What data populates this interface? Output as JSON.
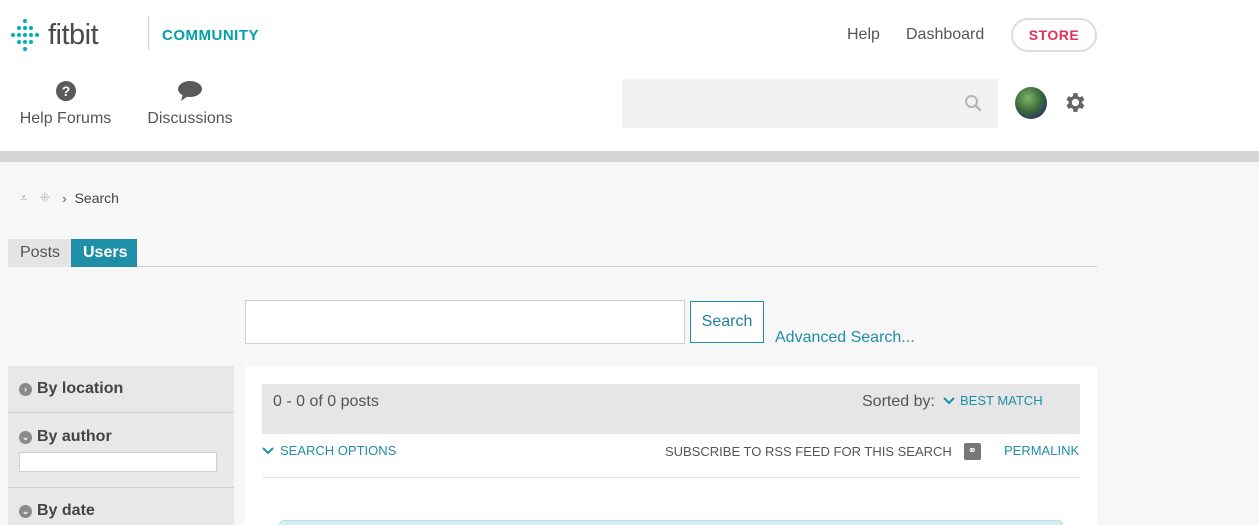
{
  "header": {
    "brand": "fitbit",
    "section": "COMMUNITY",
    "links": [
      "Help",
      "Dashboard"
    ],
    "store_label": "STORE",
    "store_color": "#e4305a",
    "nav": [
      {
        "label": "Help Forums",
        "icon": "question-circle-icon"
      },
      {
        "label": "Discussions",
        "icon": "speech-bubble-icon"
      }
    ],
    "search_placeholder": ""
  },
  "breadcrumb": {
    "items": [
      "Search"
    ]
  },
  "tabs": {
    "posts": "Posts",
    "users": "Users",
    "active": "Users"
  },
  "search": {
    "value": "",
    "button": "Search",
    "advanced": "Advanced Search..."
  },
  "filters": {
    "location": "By location",
    "author": "By author",
    "author_value": "",
    "date": "By date"
  },
  "results": {
    "count": "0 - 0 of 0 posts",
    "sorted_label": "Sorted by:",
    "sorted_value": "BEST MATCH",
    "options": "SEARCH OPTIONS",
    "rss": "SUBSCRIBE TO RSS FEED FOR THIS SEARCH",
    "permalink": "PERMALINK"
  },
  "colors": {
    "accent": "#1f8fa8",
    "brand": "#00b0b9"
  }
}
